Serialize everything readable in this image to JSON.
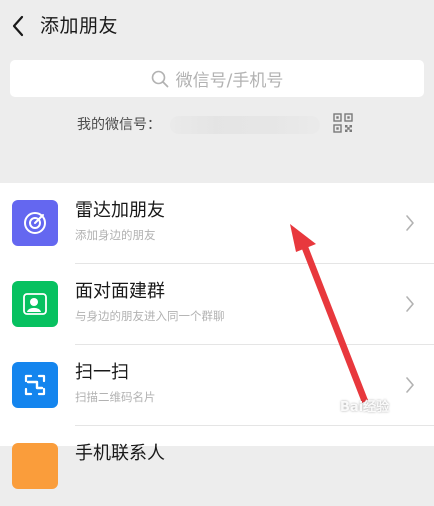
{
  "header": {
    "title": "添加朋友"
  },
  "search": {
    "placeholder": "微信号/手机号"
  },
  "my_id": {
    "label": "我的微信号："
  },
  "list": [
    {
      "name": "雷达加朋友",
      "desc": "添加身边的朋友",
      "icon": "radar-icon",
      "color": "#6467f0"
    },
    {
      "name": "面对面建群",
      "desc": "与身边的朋友进入同一个群聊",
      "icon": "group-person-icon",
      "color": "#07c160"
    },
    {
      "name": "扫一扫",
      "desc": "扫描二维码名片",
      "icon": "scan-icon",
      "color": "#1485ee"
    },
    {
      "name": "手机联系人",
      "desc": "",
      "icon": "contacts-icon",
      "color": "#fa9d3b"
    }
  ],
  "watermark": {
    "text": "Bai经验"
  },
  "colors": {
    "background": "#ededed",
    "accent_arrow": "#e8383d"
  }
}
